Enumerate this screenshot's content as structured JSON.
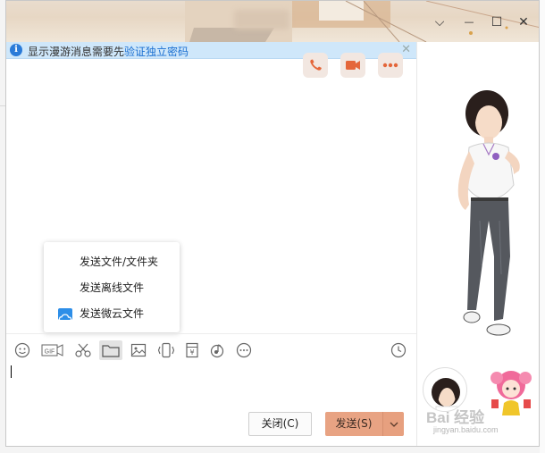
{
  "window": {
    "controls": {
      "menu": "⌵",
      "minimize": "—",
      "maximize": "☐",
      "close": "✕"
    }
  },
  "notice": {
    "text": "显示漫游消息需要先",
    "link": "验证独立密码",
    "close": "✕",
    "icon": "info-icon"
  },
  "actions": [
    {
      "name": "voice-call",
      "icon": "phone-icon"
    },
    {
      "name": "video-call",
      "icon": "video-icon"
    },
    {
      "name": "more",
      "icon": "ellipsis-icon"
    }
  ],
  "popup_menu": {
    "items": [
      {
        "label": "发送文件/文件夹"
      },
      {
        "label": "发送离线文件"
      },
      {
        "label": "发送微云文件",
        "icon": "weiyun-cloud-icon"
      }
    ]
  },
  "toolbar": {
    "tools": [
      {
        "name": "emoji",
        "icon": "smiley-icon"
      },
      {
        "name": "gif",
        "icon": "gif-icon",
        "label": "GIF"
      },
      {
        "name": "screenshot",
        "icon": "scissors-icon"
      },
      {
        "name": "file",
        "icon": "folder-icon"
      },
      {
        "name": "image",
        "icon": "image-icon"
      },
      {
        "name": "shake",
        "icon": "shake-icon"
      },
      {
        "name": "red-packet",
        "icon": "red-packet-icon",
        "label": "¥"
      },
      {
        "name": "music",
        "icon": "music-icon"
      },
      {
        "name": "more",
        "icon": "more-circle-icon"
      },
      {
        "name": "history",
        "icon": "clock-icon"
      }
    ]
  },
  "buttons": {
    "close_label": "关闭(C)",
    "send_label": "发送(S)"
  },
  "watermark": {
    "text": "Bai 经验",
    "sub": "jingyan.baidu.com"
  },
  "colors": {
    "accent_send": "#e8a383",
    "notice_bg": "#cfe7fa",
    "link": "#1a6fd1"
  }
}
